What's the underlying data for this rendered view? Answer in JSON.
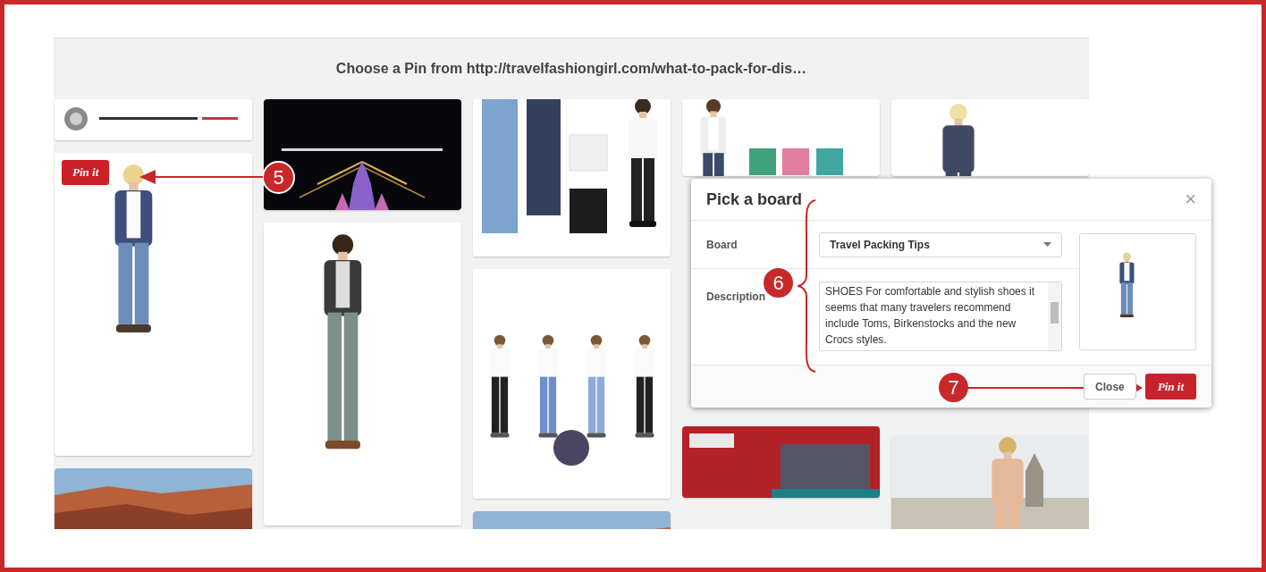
{
  "header": {
    "title": "Choose a Pin from http://travelfashiongirl.com/what-to-pack-for-dis…"
  },
  "pin_columns": [
    [
      {
        "kind": "picture"
      },
      {
        "kind": "picture",
        "pin_button": "Pin it"
      },
      {
        "kind": "picture"
      }
    ],
    [
      {
        "kind": "picture"
      },
      {
        "kind": "picture"
      }
    ],
    [
      {
        "kind": "picture"
      },
      {
        "kind": "picture"
      },
      {
        "kind": "picture"
      }
    ],
    [
      {
        "kind": "picture"
      },
      {
        "kind": "picture"
      }
    ],
    [
      {
        "kind": "picture"
      },
      {
        "kind": "picture"
      }
    ]
  ],
  "dialog": {
    "title": "Pick a board",
    "close_icon": "×",
    "board_label": "Board",
    "board_value": "Travel Packing Tips",
    "description_label": "Description",
    "description_value": "SHOES For comfortable and stylish shoes it seems that many travelers recommend include Toms, Birkenstocks and the new Crocs styles.",
    "buttons": [
      {
        "kind": "secondary",
        "label": "Close"
      },
      {
        "kind": "primary",
        "label": "Pin it"
      }
    ]
  },
  "annotations": [
    {
      "number": "5"
    },
    {
      "number": "6"
    },
    {
      "number": "7"
    }
  ]
}
